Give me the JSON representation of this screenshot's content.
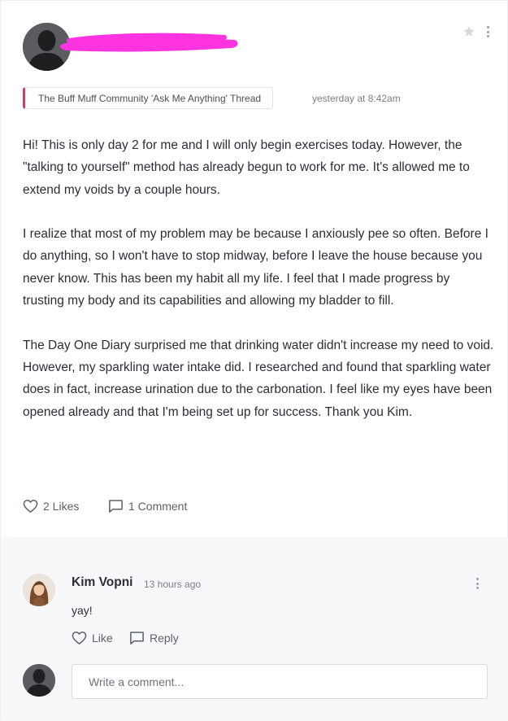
{
  "post": {
    "author_avatar_icon": "user-silhouette-icon",
    "author_name_redacted": true,
    "thread_tag": "The Buff Muff Community 'Ask Me Anything' Thread",
    "timestamp": "yesterday at 8:42am",
    "paragraphs": [
      "Hi! This is only day 2 for me and I will only begin exercises today. However, the \"talking to yourself\" method has already begun to work for me. It's allowed me to extend my voids by a couple hours.",
      "I realize that most of my problem may be because I anxiously pee so often. Before I do anything, so I won't have to stop midway, before I leave the house because you never know. This has been my habit all my life. I feel that I made progress by trusting my body and its capabilities and allowing my bladder to fill.",
      "The Day One Diary surprised me that drinking water didn't increase my need to void. However, my sparkling water intake did. I researched and found that sparkling water does in fact, increase urination due to the carbonation. I feel like my eyes have been opened already and that I'm being set up for success. Thank you Kim."
    ],
    "likes_label": "2 Likes",
    "comments_label": "1 Comment"
  },
  "comment": {
    "author": "Kim Vopni",
    "time": "13 hours ago",
    "text": "yay!",
    "like_label": "Like",
    "reply_label": "Reply"
  },
  "composer": {
    "placeholder": "Write a comment..."
  },
  "colors": {
    "accent": "#c6426e",
    "redaction": "#ff33e0",
    "muted_text": "#7a7f88",
    "comments_bg": "#f7f8fa"
  }
}
